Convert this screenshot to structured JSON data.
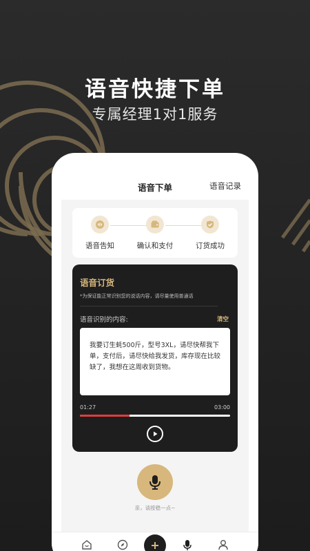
{
  "promo": {
    "headline": "语音快捷下单",
    "subline": "专属经理1对1服务"
  },
  "nav": {
    "title": "语音下单",
    "right_link": "语音记录"
  },
  "steps": [
    {
      "label": "语音告知",
      "icon": "voice-chat-icon"
    },
    {
      "label": "确认和支付",
      "icon": "wallet-icon"
    },
    {
      "label": "订货成功",
      "icon": "check-badge-icon"
    }
  ],
  "voice_card": {
    "title": "语音订货",
    "note": "*为保证能正常识别您的说话内容，请尽量使用普通话",
    "recognized_label": "语音识别的内容:",
    "clear_label": "清空",
    "recognized_text": "我要订生蚝500斤，型号3XL，请尽快帮我下单，支付后，请尽快给我发货，库存现在比较缺了，我想在这周收到货物。",
    "elapsed": "01:27",
    "duration": "03:00",
    "progress": 0.33
  },
  "record": {
    "hint": "亲，请按稳一点~"
  },
  "tabbar": {
    "items": [
      "home-icon",
      "compass-icon",
      "plus-icon",
      "microphone-icon",
      "user-icon"
    ]
  },
  "colors": {
    "accent": "#d7b77c",
    "dark": "#1e1e1e",
    "progress": "#e33c3c",
    "step_bg": "#f1e6d2"
  }
}
